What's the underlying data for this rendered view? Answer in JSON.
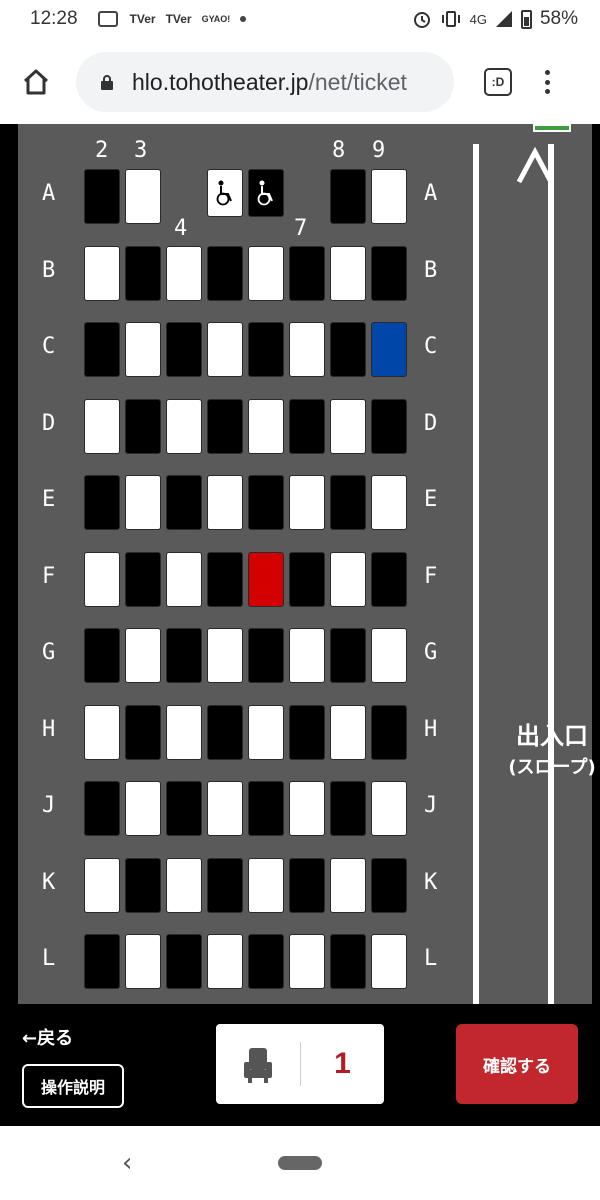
{
  "status_bar": {
    "time": "12:28",
    "notifications": [
      "TVer",
      "TVer",
      "GYAO!"
    ],
    "network": "4G",
    "battery": "58%"
  },
  "browser": {
    "url_host": "hlo.tohotheater.jp",
    "url_path": "/net/ticket",
    "tab_label": ":D"
  },
  "seatmap": {
    "column_labels": [
      "2",
      "3",
      "4",
      "7",
      "8",
      "9"
    ],
    "row_labels": [
      "A",
      "B",
      "C",
      "D",
      "E",
      "F",
      "G",
      "H",
      "J",
      "K",
      "L"
    ],
    "rows": [
      {
        "label": "A",
        "seats": [
          "b",
          "w",
          "",
          "wc-w",
          "wc-b",
          "",
          "b",
          "w"
        ]
      },
      {
        "label": "B",
        "seats": [
          "w",
          "b",
          "w",
          "b",
          "w",
          "b",
          "w",
          "b"
        ]
      },
      {
        "label": "C",
        "seats": [
          "b",
          "w",
          "b",
          "w",
          "b",
          "w",
          "b",
          "blue"
        ]
      },
      {
        "label": "D",
        "seats": [
          "w",
          "b",
          "w",
          "b",
          "w",
          "b",
          "w",
          "b"
        ]
      },
      {
        "label": "E",
        "seats": [
          "b",
          "w",
          "b",
          "w",
          "b",
          "w",
          "b",
          "w"
        ]
      },
      {
        "label": "F",
        "seats": [
          "w",
          "b",
          "w",
          "b",
          "red",
          "b",
          "w",
          "b"
        ]
      },
      {
        "label": "G",
        "seats": [
          "b",
          "w",
          "b",
          "w",
          "b",
          "w",
          "b",
          "w"
        ]
      },
      {
        "label": "H",
        "seats": [
          "w",
          "b",
          "w",
          "b",
          "w",
          "b",
          "w",
          "b"
        ]
      },
      {
        "label": "J",
        "seats": [
          "b",
          "w",
          "b",
          "w",
          "b",
          "w",
          "b",
          "w"
        ]
      },
      {
        "label": "K",
        "seats": [
          "w",
          "b",
          "w",
          "b",
          "w",
          "b",
          "w",
          "b"
        ]
      },
      {
        "label": "L",
        "seats": [
          "b",
          "w",
          "b",
          "w",
          "b",
          "w",
          "b",
          "w"
        ]
      }
    ],
    "exit_label_line1": "出入口",
    "exit_label_line2": "(スロープ)",
    "colors": {
      "selected": "#d40000",
      "blue": "#0046a8",
      "available": "#ffffff",
      "unavailable": "#000000"
    }
  },
  "action_bar": {
    "back_label": "←戻る",
    "help_label": "操作説明",
    "seat_count": "1",
    "confirm_label": "確認する"
  }
}
